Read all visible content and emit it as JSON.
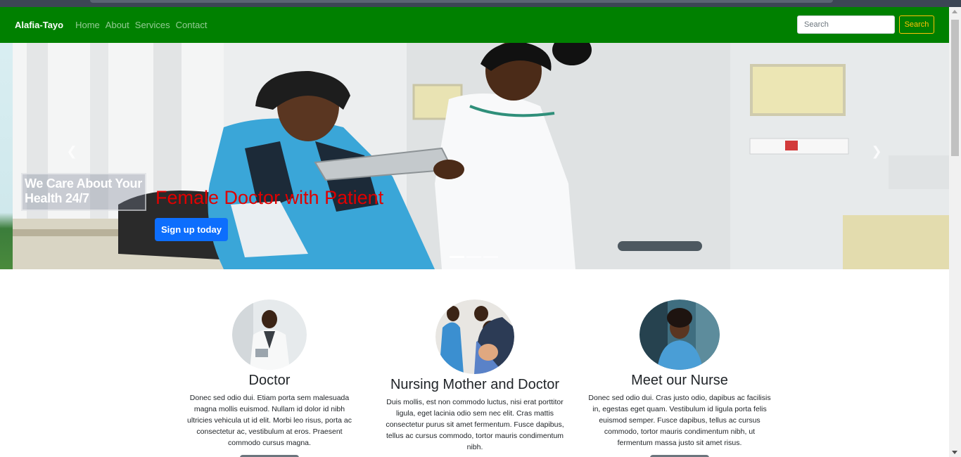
{
  "navbar": {
    "brand": "Alafia-Tayo",
    "links": [
      "Home",
      "About",
      "Services",
      "Contact"
    ],
    "search_placeholder": "Search",
    "search_button": "Search"
  },
  "hero": {
    "tag_line": "We Care About Your Health 24/7",
    "caption": "Female Doctor with Patient",
    "cta": "Sign up today",
    "prev_icon": "chevron-left-icon",
    "next_icon": "chevron-right-icon",
    "slide_count": 3,
    "active_slide": 1
  },
  "cards": [
    {
      "title": "Doctor",
      "text": "Donec sed odio dui. Etiam porta sem malesuada magna mollis euismod. Nullam id dolor id nibh ultricies vehicula ut id elit. Morbi leo risus, porta ac consectetur ac, vestibulum at eros. Praesent commodo cursus magna."
    },
    {
      "title": "Nursing Mother and Doctor",
      "text": "Duis mollis, est non commodo luctus, nisi erat porttitor ligula, eget lacinia odio sem nec elit. Cras mattis consectetur purus sit amet fermentum. Fusce dapibus, tellus ac cursus commodo, tortor mauris condimentum nibh."
    },
    {
      "title": "Meet our Nurse",
      "text": "Donec sed odio dui. Cras justo odio, dapibus ac facilisis in, egestas eget quam. Vestibulum id ligula porta felis euismod semper. Fusce dapibus, tellus ac cursus commodo, tortor mauris condimentum nibh, ut fermentum massa justo sit amet risus."
    }
  ],
  "colors": {
    "navbar": "#008000",
    "search_button": "#ffc107",
    "cta": "#0d6efd",
    "caption": "#e00000"
  }
}
